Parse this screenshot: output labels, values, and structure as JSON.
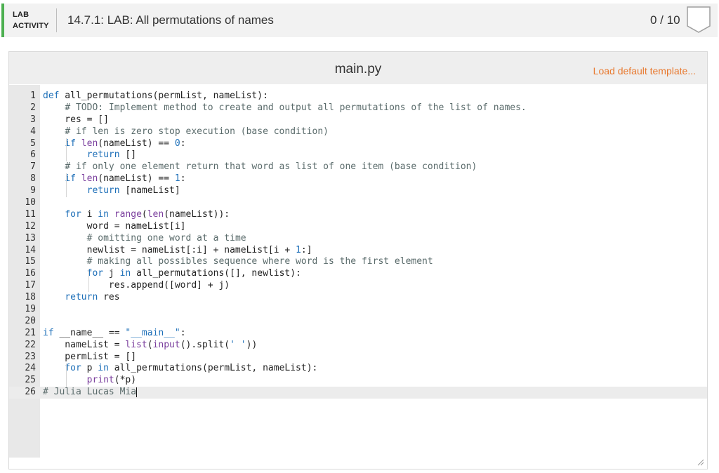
{
  "header": {
    "lab_label_1": "LAB",
    "lab_label_2": "ACTIVITY",
    "title": "14.7.1: LAB: All permutations of names",
    "score": "0 / 10",
    "accent_color": "#4caf50"
  },
  "editor": {
    "file_name": "main.py",
    "load_default_label": "Load default template...",
    "load_default_color": "#e8792f",
    "active_line": 26,
    "lines": [
      "def all_permutations(permList, nameList):",
      "    # TODO: Implement method to create and output all permutations of the list of names.",
      "    res = []",
      "    # if len is zero stop execution (base condition)",
      "    if len(nameList) == 0:",
      "        return []",
      "    # if only one element return that word as list of one item (base condition)",
      "    if len(nameList) == 1:",
      "        return [nameList]",
      "",
      "    for i in range(len(nameList)):",
      "        word = nameList[i]",
      "        # omitting one word at a time",
      "        newlist = nameList[:i] + nameList[i + 1:]",
      "        # making all possibles sequence where word is the first element",
      "        for j in all_permutations([], newlist):",
      "            res.append([word] + j)",
      "    return res",
      "",
      "",
      "if __name__ == \"__main__\":",
      "    nameList = list(input().split(' '))",
      "    permList = []",
      "    for p in all_permutations(permList, nameList):",
      "        print(*p)",
      "# Julia Lucas Mia"
    ]
  }
}
